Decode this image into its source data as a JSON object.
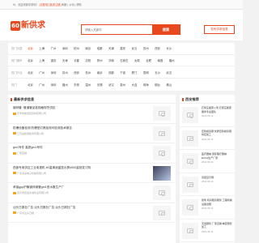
{
  "topbar": {
    "greeting": "Hi，欢迎来新供求网！",
    "login": "[请登录]",
    "register": "[免费注册]",
    "extra": "刷新 | 公司 | 帮助"
  },
  "logo": {
    "mark": "60",
    "text": "新供求"
  },
  "search": {
    "placeholder": "请输入关键词",
    "button": "搜索"
  },
  "publish_button": "发布供求信息",
  "filters": [
    {
      "label": "热门分类",
      "items": [
        "北京",
        "上海",
        "广州",
        "深圳",
        "杭州",
        "南京",
        "成都",
        "天津",
        "重庆",
        "武汉",
        "苏州",
        "西安",
        "长沙"
      ],
      "selected": 0
    },
    {
      "label": "热门城市",
      "items": [
        "北京",
        "上海",
        "重庆",
        "天津",
        "长春",
        "沈阳",
        "郑州",
        "济南",
        "石家庄",
        "太原",
        "合肥",
        "南昌",
        "福州"
      ],
      "selected": -1
    },
    {
      "label": "热门行业",
      "items": [
        "北京",
        "广州",
        "深圳",
        "苏州",
        "西安",
        "杭州",
        "南京",
        "成都",
        "宁波",
        "厦门",
        "昆明",
        "长沙",
        "武汉"
      ],
      "selected": -1
    },
    {
      "label": "热门",
      "items": [
        "北京",
        "广州",
        "深圳",
        "福州",
        "东莞",
        "温州",
        "无锡",
        "武汉",
        "泉州",
        "大连",
        "珠海",
        "烟台",
        "佛山"
      ],
      "selected": -1
    }
  ],
  "main": {
    "title": "最新供求信息",
    "items": [
      {
        "title": "镀锌管 ·管道管品各规格现货供应",
        "company": "天津市新世纪管材有限公司",
        "count": "",
        "thumb": "none"
      },
      {
        "title": "防爆设备检测 防爆型灯具检测可检测技术报告",
        "company": "江苏某检测技术有限公司",
        "count": "",
        "thumb": "none"
      },
      {
        "title": "gm1号件 高质gm1号件",
        "company": "厂家直销",
        "count": "",
        "thumb": "none"
      },
      {
        "title": "西部专用供应工业电视机 4K高清液晶显示屏4000量批发订购",
        "company": "广东省某电子科技有限公司",
        "count": "",
        "thumb": "image"
      },
      {
        "title": "承接gpp护膜镀锌钢管gm1型水管生产厂",
        "company": "武汉市宏鑫泰诚管业有限公司",
        "count": "",
        "thumb": "none"
      },
      {
        "title": "汕头日报社广告 汕头日报社广告 汕头日报社广告",
        "company": "广东省汕头日报",
        "count": "",
        "thumb": "none"
      }
    ]
  },
  "side": {
    "title": "西安推荐",
    "items": [
      {
        "title": "石家庄搬家公司 石家庄搬家服务专业团队",
        "date": "2024-05-13"
      },
      {
        "title": "压铸模具钢 优质压铸模具钢供应加工",
        "date": "2024-05-13"
      },
      {
        "title": "医疗器械 康复理疗器械 ECG2生产厂家",
        "date": "2024-05-13"
      },
      {
        "title": "双层显示屏",
        "date": "2024-05-13"
      },
      {
        "title": "建筑 机具租赁服务 工程机械设备出租",
        "date": "2024-05-13"
      },
      {
        "title": "无缝钢管 厂家直销 精密钢管加工",
        "date": "2024-05-13"
      }
    ]
  }
}
